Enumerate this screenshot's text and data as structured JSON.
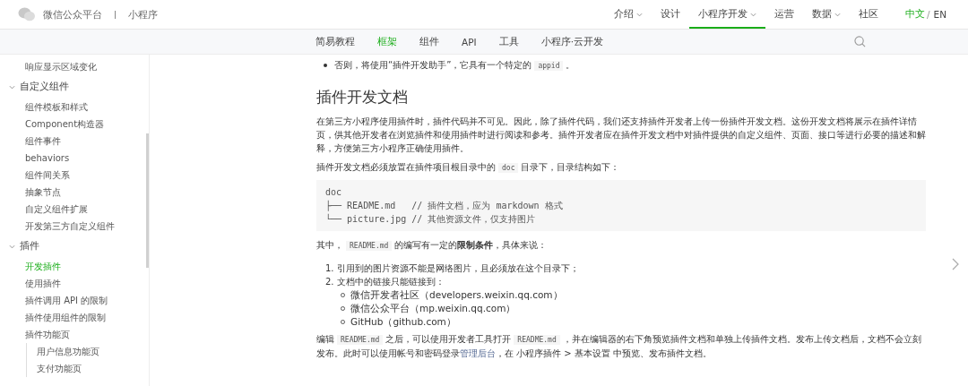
{
  "header": {
    "logo_text": "微信公众平台",
    "product": "小程序",
    "nav": [
      {
        "label": "介绍",
        "dropdown": true,
        "selected": false
      },
      {
        "label": "设计",
        "dropdown": false,
        "selected": false
      },
      {
        "label": "小程序开发",
        "dropdown": true,
        "selected": true
      },
      {
        "label": "运营",
        "dropdown": false,
        "selected": false
      },
      {
        "label": "数据",
        "dropdown": true,
        "selected": false
      },
      {
        "label": "社区",
        "dropdown": false,
        "selected": false
      }
    ],
    "languages": [
      {
        "label": "中文",
        "selected": true
      },
      {
        "label": "EN",
        "selected": false
      }
    ],
    "language_separator": "/"
  },
  "subnav": [
    {
      "label": "简易教程",
      "selected": false
    },
    {
      "label": "框架",
      "selected": true
    },
    {
      "label": "组件",
      "selected": false
    },
    {
      "label": "API",
      "selected": false
    },
    {
      "label": "工具",
      "selected": false
    },
    {
      "label": "小程序·云开发",
      "selected": false
    }
  ],
  "sidebar": {
    "items": [
      {
        "label": "响应显示区域变化",
        "selected": false
      },
      {
        "label": "自定义组件",
        "expanded": true,
        "children": [
          {
            "label": "组件模板和样式",
            "selected": false
          },
          {
            "label": "Component构造器",
            "selected": false
          },
          {
            "label": "组件事件",
            "selected": false
          },
          {
            "label": "behaviors",
            "selected": false
          },
          {
            "label": "组件间关系",
            "selected": false
          },
          {
            "label": "抽象节点",
            "selected": false
          },
          {
            "label": "自定义组件扩展",
            "selected": false
          },
          {
            "label": "开发第三方自定义组件",
            "selected": false
          }
        ]
      },
      {
        "label": "插件",
        "expanded": true,
        "children": [
          {
            "label": "开发插件",
            "selected": true
          },
          {
            "label": "使用插件",
            "selected": false
          },
          {
            "label": "插件调用 API 的限制",
            "selected": false
          },
          {
            "label": "插件使用组件的限制",
            "selected": false
          },
          {
            "label": "插件功能页",
            "selected": false,
            "children": [
              {
                "label": "用户信息功能页",
                "selected": false
              },
              {
                "label": "支付功能页",
                "selected": false
              }
            ]
          }
        ]
      }
    ]
  },
  "content": {
    "bullet": [
      {
        "kind": "text",
        "text": "否则，将使用“插件开发助手”，它具有一个特定的"
      },
      {
        "kind": "code",
        "text": "appid"
      },
      {
        "kind": "text",
        "text": "。"
      }
    ],
    "heading": "插件开发文档",
    "intro": [
      {
        "kind": "text",
        "text": "在第三方小程序使用插件时，插件代码并不可见。因此，除了插件代码，我们还支持插件开发者上传一份插件开发文档。这份开发文档将展示在插件详情页，供其他开发者在浏览插件和使用插件时进行阅读和参考。插件开发者应在插件开发文档中对插件提供的自定义组件、页面、接口等进行必要的描述和解释，方便第三方小程序正确使用插件。"
      }
    ],
    "location": [
      {
        "kind": "text",
        "text": "插件开发文档必须放置在插件项目根目录中的"
      },
      {
        "kind": "code",
        "text": "doc"
      },
      {
        "kind": "text",
        "text": "目录下，目录结构如下："
      }
    ],
    "code_lines": [
      "doc",
      "├── README.md   // 插件文档，应为 markdown 格式",
      "└── picture.jpg // 其他资源文件，仅支持图片"
    ],
    "limits": [
      {
        "kind": "text",
        "text": "其中，"
      },
      {
        "kind": "code",
        "text": "README.md"
      },
      {
        "kind": "text",
        "text": "的编写有一定的"
      },
      {
        "kind": "bold",
        "text": "限制条件"
      },
      {
        "kind": "text",
        "text": "，具体来说："
      }
    ],
    "rules": [
      {
        "marker": "1.",
        "text": "引用到的图片资源不能是网络图片，且必须放在这个目录下；"
      },
      {
        "marker": "2.",
        "text": "文档中的链接只能链接到：",
        "children": [
          "微信开发者社区（developers.weixin.qq.com）",
          "微信公众平台（mp.weixin.qq.com）",
          "GitHub（github.com）"
        ]
      }
    ],
    "publish": [
      {
        "kind": "text",
        "text": "编辑"
      },
      {
        "kind": "code",
        "text": "README.md"
      },
      {
        "kind": "text",
        "text": "之后，可以使用开发者工具打开"
      },
      {
        "kind": "code",
        "text": "README.md"
      },
      {
        "kind": "text",
        "text": "，并在编辑器的右下角预览插件文档和单独上传插件文档。发布上传文档后，文档不会立刻发布。此时可以使用帐号和密码登录"
      },
      {
        "kind": "link",
        "text": "管理后台"
      },
      {
        "kind": "text",
        "text": "，在 小程序插件 > 基本设置 中预览、发布插件文档。"
      }
    ]
  }
}
